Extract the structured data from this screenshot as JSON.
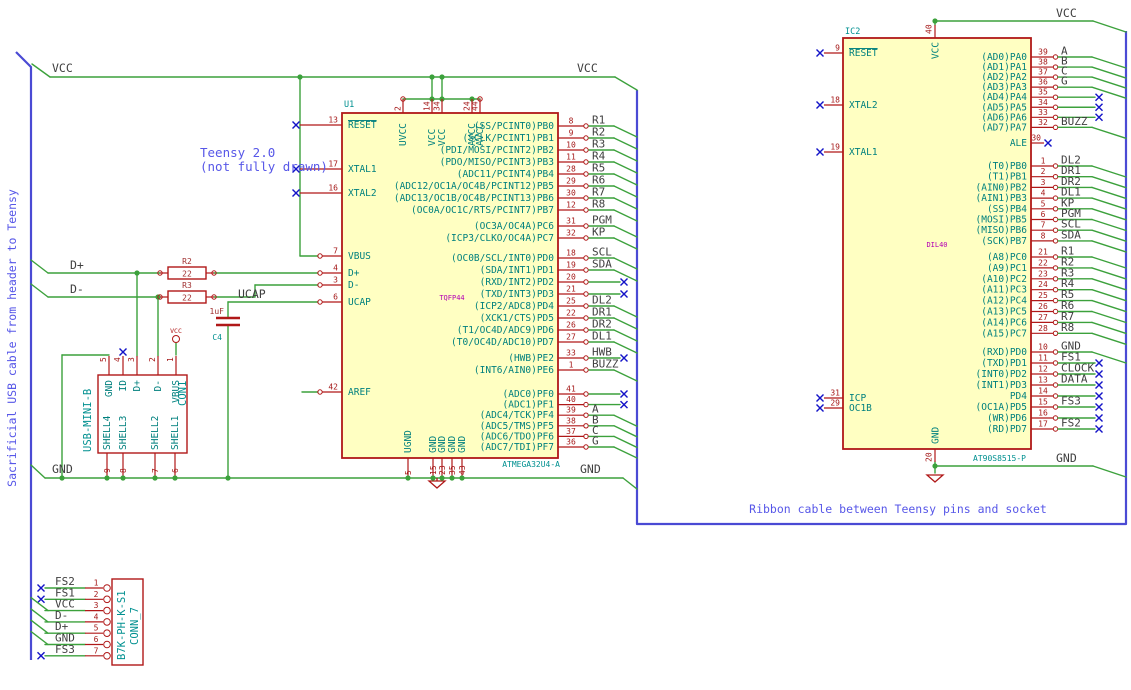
{
  "notes": {
    "teensy_line1": "Teensy 2.0",
    "teensy_line2": "(not fully drawn)",
    "ribbon": "Ribbon cable between Teensy pins and socket",
    "sacrificial": "Sacrificial USB cable from header to Teensy"
  },
  "labels": {
    "vcc_left": "VCC",
    "vcc_right": "VCC",
    "gnd_left": "GND",
    "gnd_right": "GND",
    "d_plus": "D+",
    "d_minus": "D-",
    "ucap": "UCAP",
    "vcc_ic2": "VCC",
    "gnd_ic2": "GND"
  },
  "power": {
    "vcc": "VCC"
  },
  "left_ic": {
    "ref": "U1",
    "value": "TQFP44",
    "part": "ATMEGA32U4-A",
    "top_pins": [
      {
        "num": "2",
        "name": "UVCC"
      },
      {
        "num": "14",
        "name": "VCC"
      },
      {
        "num": "34",
        "name": "VCC"
      },
      {
        "num": "24",
        "name": "AVCC"
      },
      {
        "num": "44",
        "name": "AVCC"
      }
    ],
    "bottom_pins": [
      {
        "num": "5",
        "name": "UGND"
      },
      {
        "num": "15",
        "name": "GND"
      },
      {
        "num": "23",
        "name": "GND"
      },
      {
        "num": "35",
        "name": "GND"
      },
      {
        "num": "43",
        "name": "GND"
      }
    ],
    "left_pins": [
      {
        "num": "13",
        "name": "RESET",
        "nc": true,
        "ov": true
      },
      {
        "num": "17",
        "name": "XTAL1",
        "nc": true
      },
      {
        "num": "16",
        "name": "XTAL2",
        "nc": true
      },
      {
        "num": "7",
        "name": "VBUS"
      },
      {
        "num": "4",
        "name": "D+"
      },
      {
        "num": "3",
        "name": "D-"
      },
      {
        "num": "6",
        "name": "UCAP"
      },
      {
        "num": "42",
        "name": "AREF"
      }
    ],
    "pb_pins": [
      {
        "num": "8",
        "name": "(SS/PCINT0)PB0",
        "label": "R1",
        "bus": true
      },
      {
        "num": "9",
        "name": "(SCLK/PCINT1)PB1",
        "label": "R2",
        "bus": true
      },
      {
        "num": "10",
        "name": "(PDI/MOSI/PCINT2)PB2",
        "label": "R3",
        "bus": true
      },
      {
        "num": "11",
        "name": "(PDO/MISO/PCINT3)PB3",
        "label": "R4",
        "bus": true
      },
      {
        "num": "28",
        "name": "(ADC11/PCINT4)PB4",
        "label": "R5",
        "bus": true
      },
      {
        "num": "29",
        "name": "(ADC12/OC1A/OC4B/PCINT12)PB5",
        "label": "R6",
        "bus": true
      },
      {
        "num": "30",
        "name": "(ADC13/OC1B/OC4B/PCINT13)PB6",
        "label": "R7",
        "bus": true
      },
      {
        "num": "12",
        "name": "(OC0A/OC1C/RTS/PCINT7)PB7",
        "label": "R8",
        "bus": true
      }
    ],
    "pc_pins": [
      {
        "num": "31",
        "name": "(OC3A/OC4A)PC6",
        "label": "PGM",
        "bus": true
      },
      {
        "num": "32",
        "name": "(ICP3/CLKO/OC4A)PC7",
        "label": "KP",
        "bus": true
      }
    ],
    "pd_pins": [
      {
        "num": "18",
        "name": "(OC0B/SCL/INT0)PD0",
        "label": "SCL",
        "bus": true
      },
      {
        "num": "19",
        "name": "(SDA/INT1)PD1",
        "label": "SDA",
        "bus": true
      },
      {
        "num": "20",
        "name": "(RXD/INT2)PD2",
        "label": "",
        "nc": true
      },
      {
        "num": "21",
        "name": "(TXD/INT3)PD3",
        "label": "",
        "nc": true
      },
      {
        "num": "25",
        "name": "(ICP2/ADC8)PD4",
        "label": "DL2",
        "bus": true
      },
      {
        "num": "22",
        "name": "(XCK1/CTS)PD5",
        "label": "DR1",
        "bus": true
      },
      {
        "num": "26",
        "name": "(T1/OC4D/ADC9)PD6",
        "label": "DR2",
        "bus": true
      },
      {
        "num": "27",
        "name": "(T0/OC4D/ADC10)PD7",
        "label": "DL1",
        "bus": true
      }
    ],
    "pe_pins": [
      {
        "num": "33",
        "name": "(HWB)PE2",
        "label": "HWB",
        "nc": true
      },
      {
        "num": "1",
        "name": "(INT6/AIN0)PE6",
        "label": "BUZZ",
        "bus": true
      }
    ],
    "pf_pins": [
      {
        "num": "41",
        "name": "(ADC0)PF0",
        "label": "",
        "nc": true
      },
      {
        "num": "40",
        "name": "(ADC1)PF1",
        "label": "",
        "nc": true
      },
      {
        "num": "39",
        "name": "(ADC4/TCK)PF4",
        "label": "A",
        "bus": true
      },
      {
        "num": "38",
        "name": "(ADC5/TMS)PF5",
        "label": "B",
        "bus": true
      },
      {
        "num": "37",
        "name": "(ADC6/TDO)PF6",
        "label": "C",
        "bus": true
      },
      {
        "num": "36",
        "name": "(ADC7/TDI)PF7",
        "label": "G",
        "bus": true
      }
    ]
  },
  "right_ic": {
    "ref": "IC2",
    "value": "DIL40",
    "part": "AT90S8515-P",
    "top_pin": {
      "num": "40",
      "name": "VCC"
    },
    "bottom_pin": {
      "num": "20",
      "name": "GND"
    },
    "left_pins": [
      {
        "num": "9",
        "name": "RESET",
        "ov": true
      },
      {
        "num": "18",
        "name": "XTAL2"
      },
      {
        "num": "19",
        "name": "XTAL1"
      },
      {
        "num": "31",
        "name": "ICP"
      },
      {
        "num": "29",
        "name": "OC1B"
      }
    ],
    "pa_pins": [
      {
        "num": "39",
        "name": "(AD0)PA0",
        "label": "A",
        "bus": true
      },
      {
        "num": "38",
        "name": "(AD1)PA1",
        "label": "B",
        "bus": true
      },
      {
        "num": "37",
        "name": "(AD2)PA2",
        "label": "C",
        "bus": true
      },
      {
        "num": "36",
        "name": "(AD3)PA3",
        "label": "G",
        "bus": true
      },
      {
        "num": "35",
        "name": "(AD4)PA4",
        "label": "",
        "nc": true
      },
      {
        "num": "34",
        "name": "(AD5)PA5",
        "label": "",
        "nc": true
      },
      {
        "num": "33",
        "name": "(AD6)PA6",
        "label": "",
        "nc": true
      },
      {
        "num": "32",
        "name": "(AD7)PA7",
        "label": "BUZZ",
        "bus": true
      }
    ],
    "ale_pin": {
      "num": "30",
      "name": "ALE"
    },
    "pb_pins": [
      {
        "num": "1",
        "name": "(T0)PB0",
        "label": "DL2",
        "bus": true
      },
      {
        "num": "2",
        "name": "(T1)PB1",
        "label": "DR1",
        "bus": true
      },
      {
        "num": "3",
        "name": "(AIN0)PB2",
        "label": "DR2",
        "bus": true
      },
      {
        "num": "4",
        "name": "(AIN1)PB3",
        "label": "DL1",
        "bus": true
      },
      {
        "num": "5",
        "name": "(SS)PB4",
        "label": "KP",
        "bus": true
      },
      {
        "num": "6",
        "name": "(MOSI)PB5",
        "label": "PGM",
        "bus": true
      },
      {
        "num": "7",
        "name": "(MISO)PB6",
        "label": "SCL",
        "bus": true
      },
      {
        "num": "8",
        "name": "(SCK)PB7",
        "label": "SDA",
        "bus": true
      }
    ],
    "pc_pins": [
      {
        "num": "21",
        "name": "(A8)PC0",
        "label": "R1",
        "bus": true
      },
      {
        "num": "22",
        "name": "(A9)PC1",
        "label": "R2",
        "bus": true
      },
      {
        "num": "23",
        "name": "(A10)PC2",
        "label": "R3",
        "bus": true
      },
      {
        "num": "24",
        "name": "(A11)PC3",
        "label": "R4",
        "bus": true
      },
      {
        "num": "25",
        "name": "(A12)PC4",
        "label": "R5",
        "bus": true
      },
      {
        "num": "26",
        "name": "(A13)PC5",
        "label": "R6",
        "bus": true
      },
      {
        "num": "27",
        "name": "(A14)PC6",
        "label": "R7",
        "bus": true
      },
      {
        "num": "28",
        "name": "(A15)PC7",
        "label": "R8",
        "bus": true
      }
    ],
    "pd_pins": [
      {
        "num": "10",
        "name": "(RXD)PD0",
        "label": "GND",
        "bus": true
      },
      {
        "num": "11",
        "name": "(TXD)PD1",
        "label": "FS1",
        "nc": true
      },
      {
        "num": "12",
        "name": "(INT0)PD2",
        "label": "CLOCK",
        "nc": true
      },
      {
        "num": "13",
        "name": "(INT1)PD3",
        "label": "DATA",
        "nc": true
      },
      {
        "num": "14",
        "name": "PD4",
        "label": "",
        "nc": true
      },
      {
        "num": "15",
        "name": "(OC1A)PD5",
        "label": "FS3",
        "nc": true
      },
      {
        "num": "16",
        "name": "(WR)PD6",
        "label": "",
        "nc": true
      },
      {
        "num": "17",
        "name": "(RD)PD7",
        "label": "FS2",
        "nc": true
      }
    ]
  },
  "usb": {
    "ref": "CON1",
    "value": "USB-MINI-B",
    "top_pins": [
      {
        "num": "5",
        "name": "GND"
      },
      {
        "num": "4",
        "name": "ID",
        "nc": true
      },
      {
        "num": "3",
        "name": "D+"
      },
      {
        "num": "2",
        "name": "D-"
      },
      {
        "num": "1",
        "name": "VBUS"
      }
    ],
    "bottom_pins": [
      {
        "num": "9",
        "name": "SHELL4"
      },
      {
        "num": "8",
        "name": "SHELL3"
      },
      {
        "num": "7",
        "name": "SHELL2"
      },
      {
        "num": "6",
        "name": "SHELL1"
      }
    ]
  },
  "conn7": {
    "ref": "CONN_7",
    "value": "B7K-PH-K-S1",
    "rows": [
      {
        "num": "1",
        "label": "FS2",
        "nc": true
      },
      {
        "num": "2",
        "label": "FS1",
        "nc": true
      },
      {
        "num": "3",
        "label": "VCC"
      },
      {
        "num": "4",
        "label": "D-"
      },
      {
        "num": "5",
        "label": "D+"
      },
      {
        "num": "6",
        "label": "GND"
      },
      {
        "num": "7",
        "label": "FS3",
        "nc": true
      }
    ]
  },
  "r2": {
    "ref": "R2",
    "value": "22"
  },
  "r3": {
    "ref": "R3",
    "value": "22"
  },
  "c4": {
    "ref": "C4",
    "value": "1uF"
  },
  "colors": {
    "wire": "#3CA13C",
    "cable_bus": "#4A4AD4",
    "symbol_outline": "#B01818",
    "symbol_fill": "#FFFFC2",
    "pin_name": "#00807E",
    "pin_number": "#A51A1A",
    "net_label": "#3F3F3F",
    "note_text": "#5757E8",
    "value_text": "#B400B4",
    "no_connect": "#1414C8",
    "background": "#FFFFFF"
  }
}
